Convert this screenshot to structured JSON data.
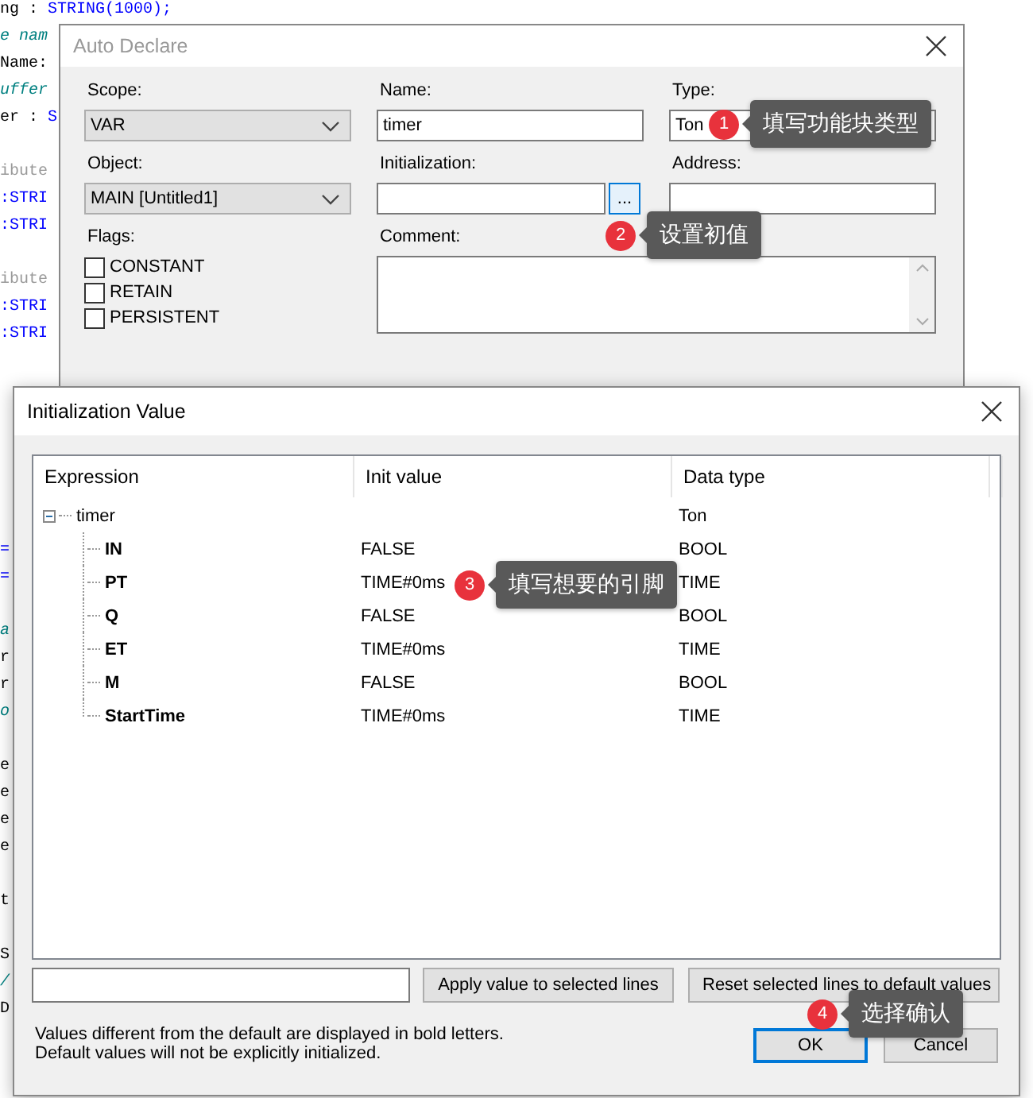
{
  "editor": {
    "lines": [
      {
        "kind": "declaration",
        "name": "ng : ",
        "type": "STRING(1000);"
      },
      {
        "kind": "comment",
        "text": "e nam"
      },
      {
        "kind": "plain",
        "text": "Name:"
      },
      {
        "kind": "comment",
        "text": "uffer"
      },
      {
        "kind": "declaration",
        "name": "er : ",
        "type": "S"
      },
      {
        "kind": "blank"
      },
      {
        "kind": "attribute",
        "text": "ibute"
      },
      {
        "kind": "type",
        "text": ":STRI"
      },
      {
        "kind": "type",
        "text": ":STRI"
      },
      {
        "kind": "blank"
      },
      {
        "kind": "attribute",
        "text": "ibute"
      },
      {
        "kind": "type",
        "text": ":STRI"
      },
      {
        "kind": "type",
        "text": ":STRI"
      },
      {
        "kind": "blank"
      },
      {
        "kind": "blank"
      },
      {
        "kind": "blank"
      },
      {
        "kind": "blank"
      },
      {
        "kind": "blank"
      },
      {
        "kind": "blank"
      },
      {
        "kind": "blank"
      },
      {
        "kind": "type",
        "text": "="
      },
      {
        "kind": "type",
        "text": "="
      },
      {
        "kind": "blank"
      },
      {
        "kind": "comment",
        "text": "a"
      },
      {
        "kind": "plain",
        "text": "r"
      },
      {
        "kind": "plain",
        "text": "r"
      },
      {
        "kind": "comment",
        "text": "o"
      },
      {
        "kind": "blank"
      },
      {
        "kind": "plain",
        "text": "e"
      },
      {
        "kind": "plain",
        "text": "e"
      },
      {
        "kind": "plain",
        "text": "e"
      },
      {
        "kind": "plain",
        "text": "e"
      },
      {
        "kind": "blank"
      },
      {
        "kind": "plain",
        "text": "t"
      },
      {
        "kind": "blank"
      },
      {
        "kind": "plain",
        "text": "S"
      },
      {
        "kind": "comment",
        "text": "/"
      },
      {
        "kind": "plain",
        "text": "D"
      }
    ]
  },
  "auto_declare": {
    "title": "Auto Declare",
    "scope": {
      "label": "Scope:",
      "value": "VAR"
    },
    "name": {
      "label": "Name:",
      "value": "timer"
    },
    "type": {
      "label": "Type:",
      "value": "Ton"
    },
    "object": {
      "label": "Object:",
      "value": "MAIN [Untitled1]"
    },
    "initialization": {
      "label": "Initialization:",
      "button": "..."
    },
    "address": {
      "label": "Address:"
    },
    "flags": {
      "label": "Flags:",
      "items": [
        {
          "label": "CONSTANT",
          "checked": false
        },
        {
          "label": "RETAIN",
          "checked": false
        },
        {
          "label": "PERSISTENT",
          "checked": false
        }
      ]
    },
    "comment": {
      "label": "Comment:"
    }
  },
  "init_dialog": {
    "title": "Initialization Value",
    "columns": [
      "Expression",
      "Init value",
      "Data type"
    ],
    "rows": [
      {
        "expression": "timer",
        "data_type": "Ton",
        "expanded": true,
        "children": [
          {
            "expression": "IN",
            "init_value": "FALSE",
            "data_type": "BOOL"
          },
          {
            "expression": "PT",
            "init_value": "TIME#0ms",
            "data_type": "TIME"
          },
          {
            "expression": "Q",
            "init_value": "FALSE",
            "data_type": "BOOL"
          },
          {
            "expression": "ET",
            "init_value": "TIME#0ms",
            "data_type": "TIME"
          },
          {
            "expression": "M",
            "init_value": "FALSE",
            "data_type": "BOOL"
          },
          {
            "expression": "StartTime",
            "init_value": "TIME#0ms",
            "data_type": "TIME"
          }
        ]
      }
    ],
    "apply_button": "Apply value to selected lines",
    "reset_button": "Reset selected lines to default values",
    "notes": [
      "Values different from the default are displayed in bold letters.",
      "Default values will not be explicitly initialized."
    ],
    "ok_button": "OK",
    "cancel_button": "Cancel"
  },
  "callouts": [
    {
      "number": "1",
      "text": "填写功能块类型"
    },
    {
      "number": "2",
      "text": "设置初值"
    },
    {
      "number": "3",
      "text": "填写想要的引脚"
    },
    {
      "number": "4",
      "text": "选择确认"
    }
  ]
}
